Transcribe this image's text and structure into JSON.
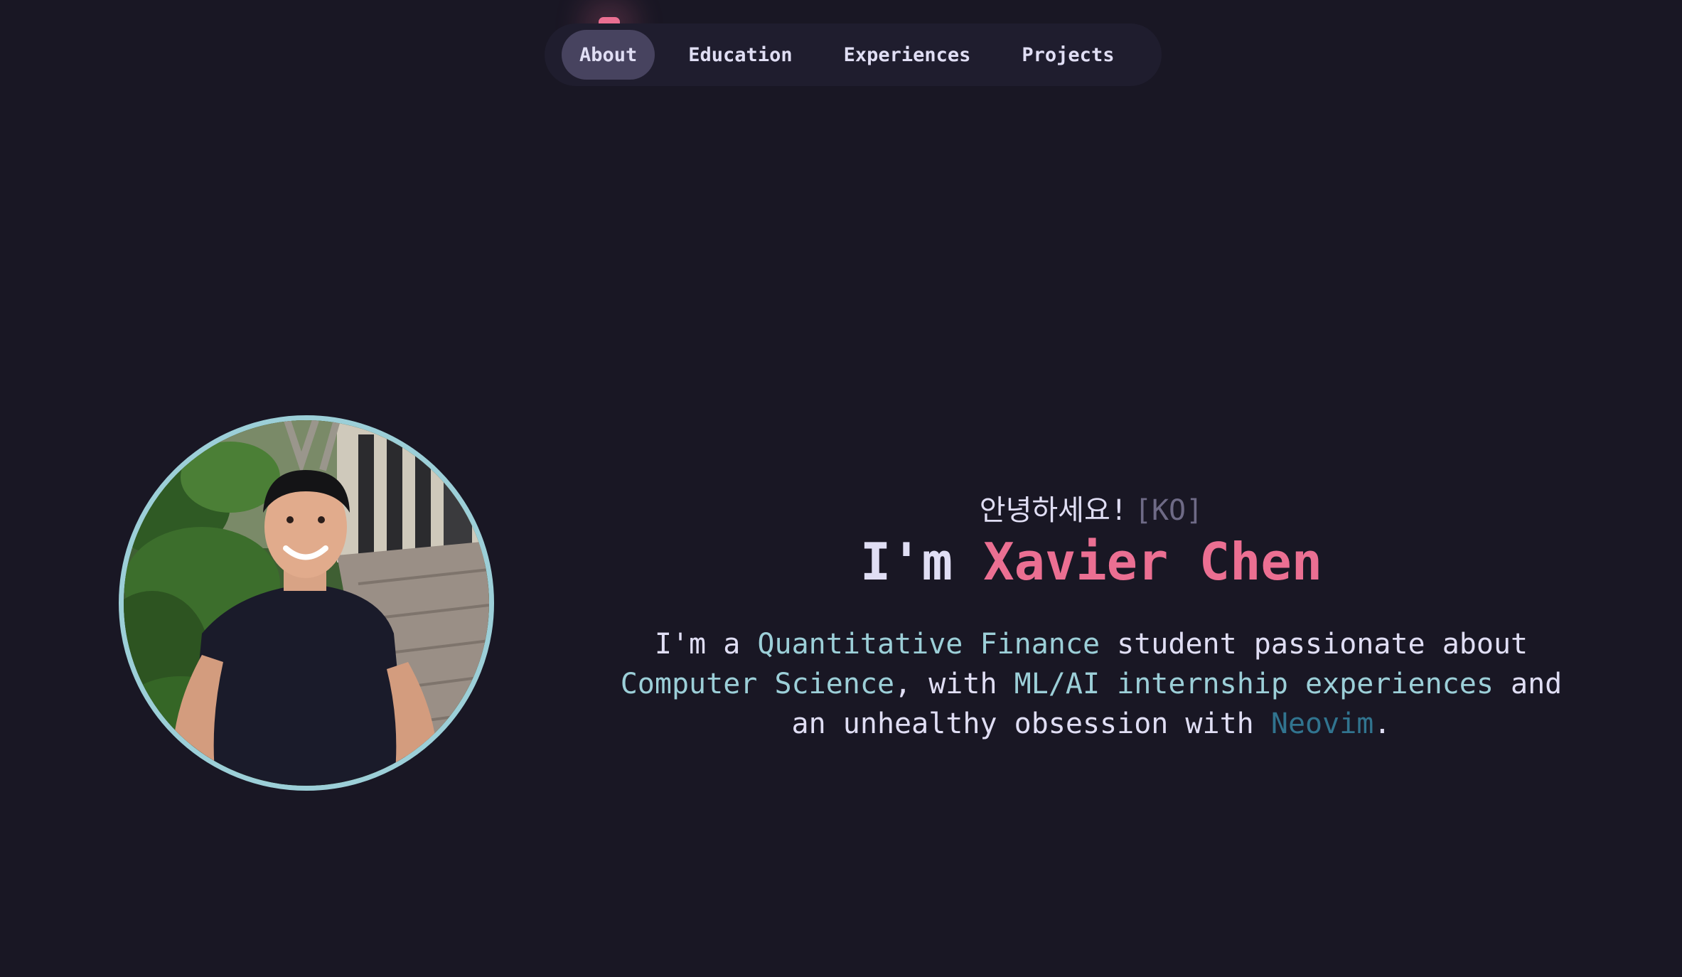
{
  "nav": {
    "items": [
      {
        "label": "About",
        "active": true
      },
      {
        "label": "Education",
        "active": false
      },
      {
        "label": "Experiences",
        "active": false
      },
      {
        "label": "Projects",
        "active": false
      }
    ]
  },
  "hero": {
    "greeting": "안녕하세요!",
    "greeting_lang": "[KO]",
    "title_prefix": "I'm",
    "name": "Xavier Chen",
    "bio": {
      "p1": "I'm a",
      "h1": "Quantitative Finance",
      "p2": "student passionate about",
      "h2": "Computer Science",
      "p3": ", with",
      "h3": "ML/AI internship experiences",
      "p4": "and an unhealthy obsession with",
      "h4": "Neovim",
      "p5": "."
    }
  },
  "avatar": {
    "icon": "profile-photo"
  },
  "colors": {
    "background": "#191724",
    "surface": "#1f1d2e",
    "nav_active": "#47435f",
    "text": "#e0def4",
    "muted": "#6e6a86",
    "love": "#eb6f92",
    "foam": "#9ccfd8",
    "pine": "#31748f"
  }
}
